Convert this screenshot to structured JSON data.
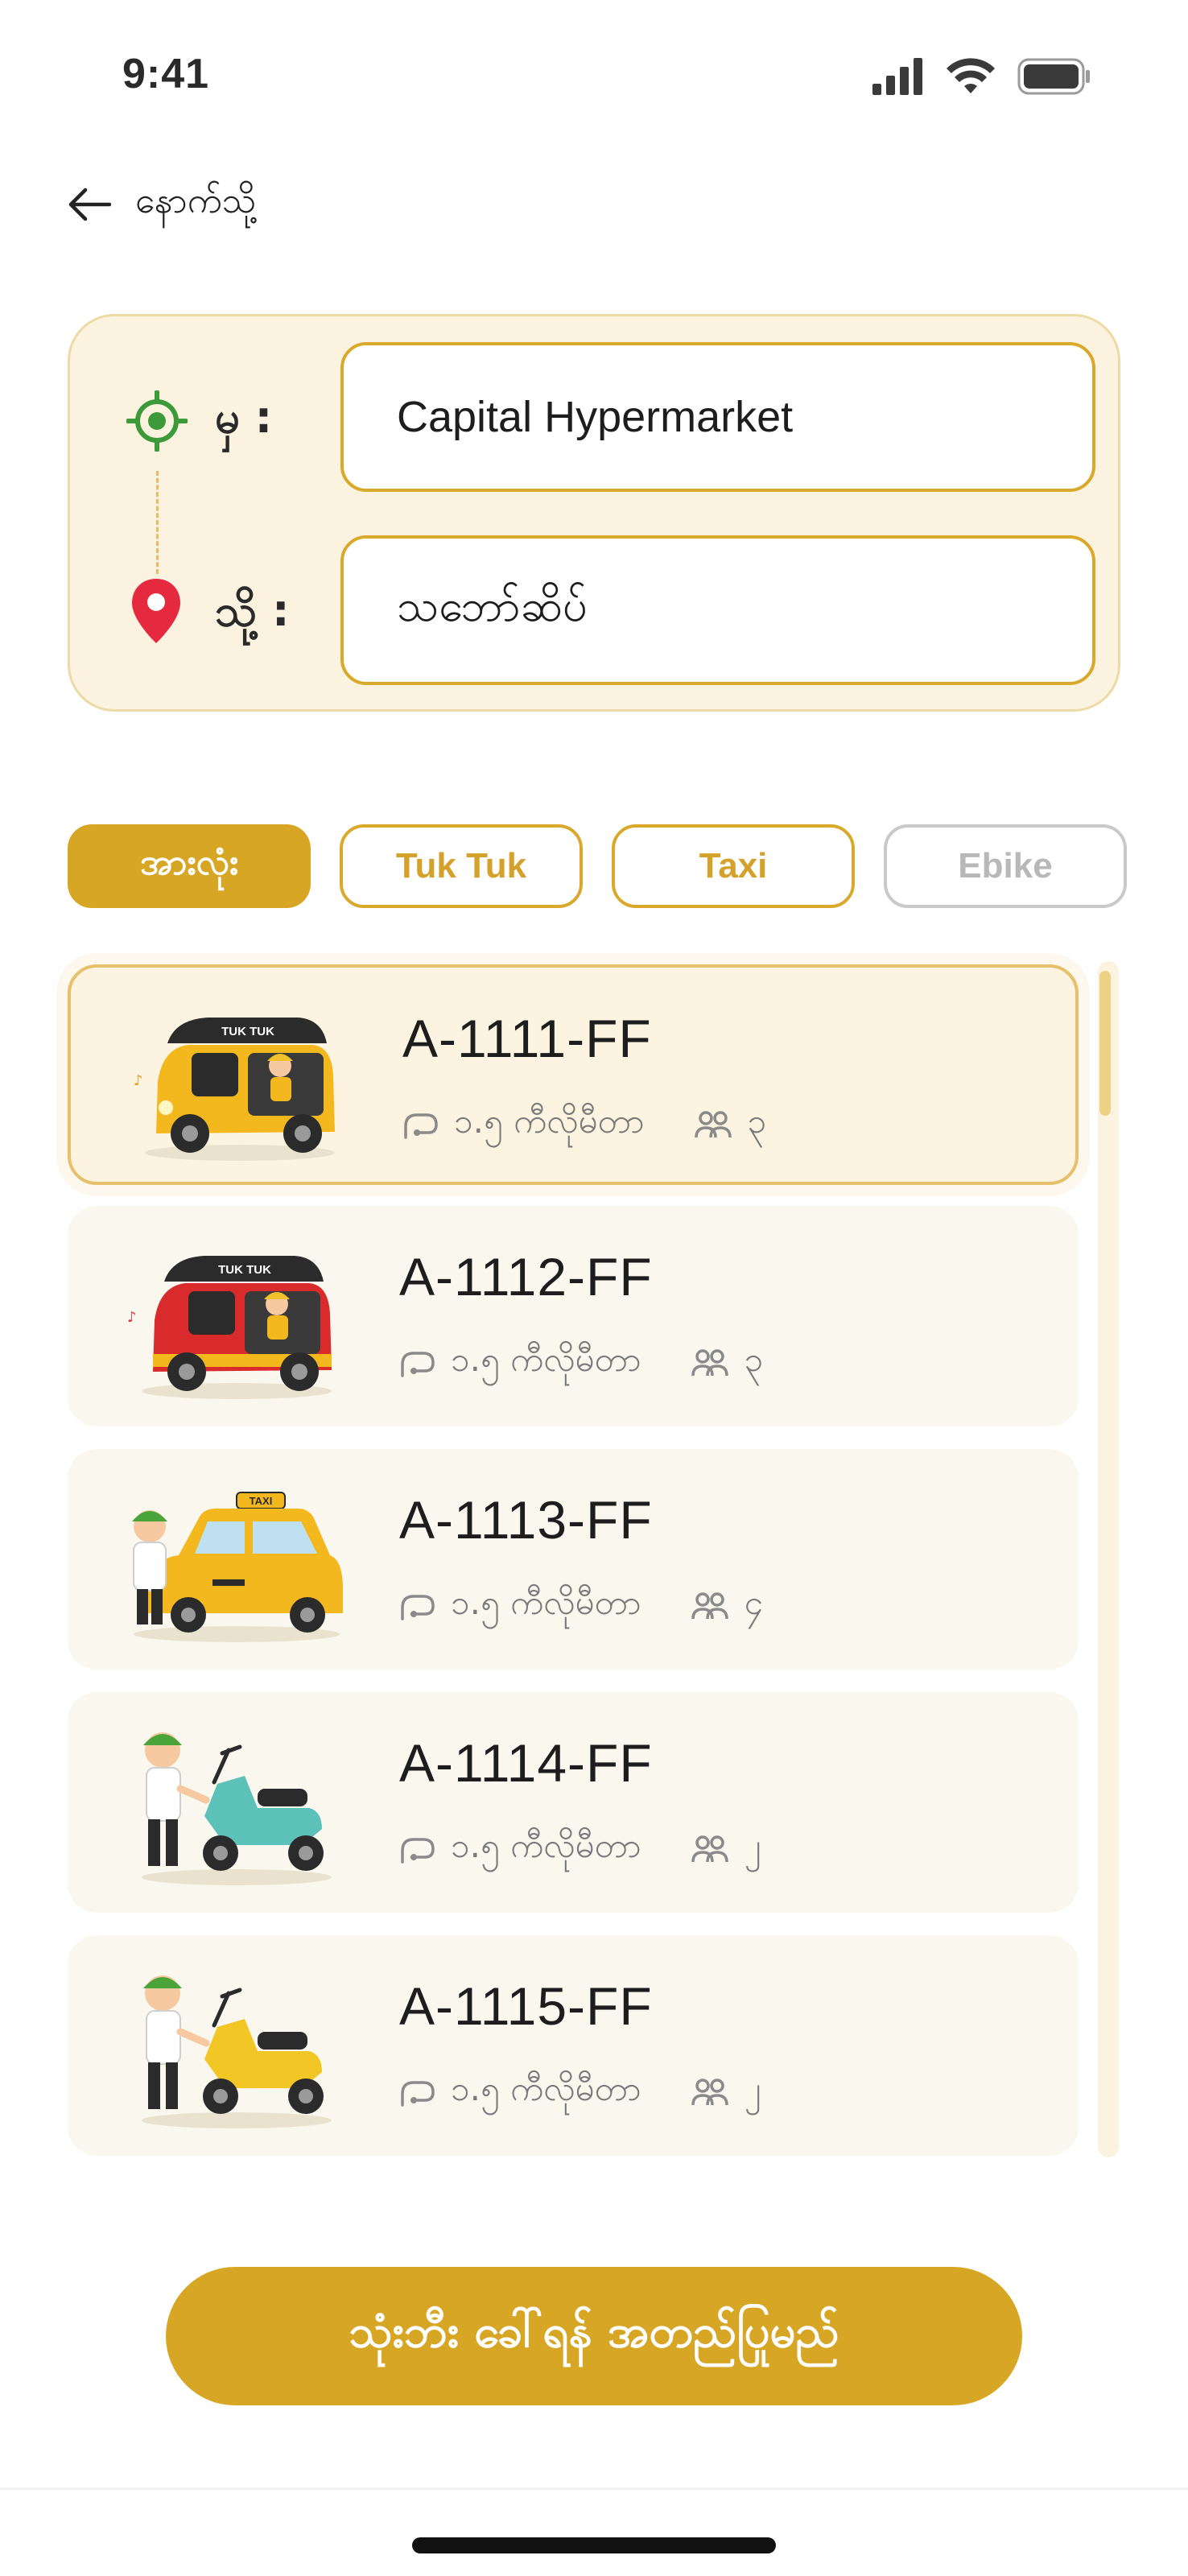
{
  "status_bar": {
    "time": "9:41",
    "icons": [
      "cellular-signal-icon",
      "wifi-icon",
      "battery-icon"
    ]
  },
  "back": {
    "icon": "arrow-left-icon",
    "label": "နောက်သို့"
  },
  "route": {
    "from_label": "မှ :",
    "from_value": "Capital Hypermarket",
    "from_icon": "location-target-icon",
    "to_label": "သို့ :",
    "to_value": "သဘော်ဆိပ်",
    "to_icon": "map-pin-icon"
  },
  "filters": [
    {
      "label": "အားလုံး",
      "state": "active"
    },
    {
      "label": "Tuk Tuk",
      "state": "default"
    },
    {
      "label": "Taxi",
      "state": "default"
    },
    {
      "label": "Ebike",
      "state": "disabled"
    }
  ],
  "vehicles": [
    {
      "plate": "A-1111-FF",
      "distance": "၁.၅ ကီလိုမီတာ",
      "seats": "၃",
      "image": "yellow-tuk-tuk",
      "selected": true
    },
    {
      "plate": "A-1112-FF",
      "distance": "၁.၅ ကီလိုမီတာ",
      "seats": "၃",
      "image": "red-tuk-tuk",
      "selected": false
    },
    {
      "plate": "A-1113-FF",
      "distance": "၁.၅ ကီလိုမီတာ",
      "seats": "၄",
      "image": "yellow-taxi",
      "selected": false
    },
    {
      "plate": "A-1114-FF",
      "distance": "၁.၅ ကီလိုမီတာ",
      "seats": "၂",
      "image": "teal-ebike",
      "selected": false
    },
    {
      "plate": "A-1115-FF",
      "distance": "၁.၅ ကီလိုမီတာ",
      "seats": "၂",
      "image": "yellow-ebike",
      "selected": false
    }
  ],
  "confirm_button": {
    "label": "သုံးဘီး ခေါ်ရန် အတည်ပြုမည်"
  },
  "colors": {
    "accent": "#d7a625",
    "card_bg": "#fbf3df",
    "pin_red": "#e52a3f",
    "target_green": "#3d9a3a"
  }
}
